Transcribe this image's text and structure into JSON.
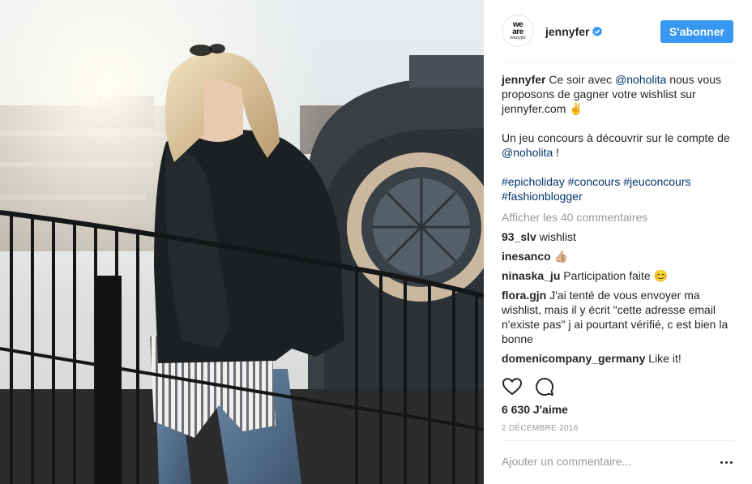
{
  "header": {
    "logo_line1": "we",
    "logo_line2": "are",
    "logo_line3": "Jennyfer",
    "username": "jennyfer",
    "follow_label": "S'abonner"
  },
  "caption": {
    "username": "jennyfer",
    "part1": " Ce soir avec ",
    "mention1": "@noholita",
    "part2": " nous vous proposons de gagner votre wishlist sur jennyfer.com ✌️",
    "part3": "Un jeu concours à découvrir sur le compte de ",
    "mention2": "@noholita",
    "part4": " !",
    "hashtags": [
      "#epicholiday",
      "#concours",
      "#jeuconcours",
      "#fashionblogger"
    ]
  },
  "view_all_comments": "Afficher les 40 commentaires",
  "comments": [
    {
      "user": "93_slv",
      "text": "wishlist"
    },
    {
      "user": "inesanco",
      "text": "👍🏼"
    },
    {
      "user": "ninaska_ju",
      "text": "Participation faite 😊"
    },
    {
      "user": "flora.gjn",
      "text": "J'ai tenté de vous envoyer ma wishlist, mais il y écrit \"cette adresse email n'existe pas\" j ai pourtant vérifié, c est bien la bonne"
    },
    {
      "user": "domenicompany_germany",
      "text": "Like it!"
    }
  ],
  "likes": "6 630 J'aime",
  "date": "2 DÉCEMBRE 2016",
  "add_comment_placeholder": "Ajouter un commentaire...",
  "colors": {
    "accent": "#3897f0",
    "link": "#003569",
    "muted": "#999999",
    "text": "#262626"
  },
  "icons": [
    "verified-badge-icon",
    "heart-icon",
    "comment-icon",
    "more-options-icon"
  ]
}
